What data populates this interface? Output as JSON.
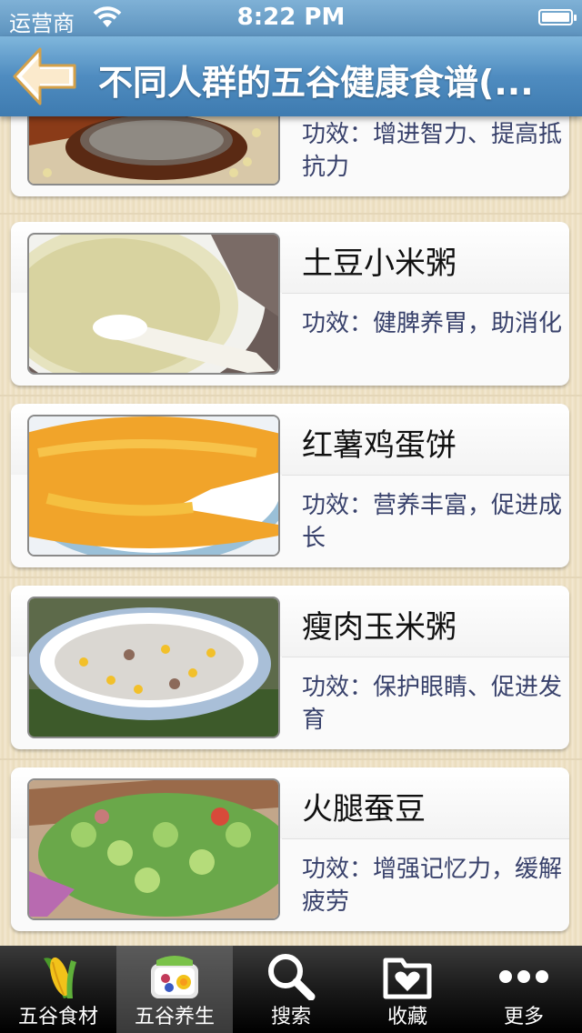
{
  "status_bar": {
    "carrier": "运营商",
    "time": "8:22 PM"
  },
  "nav": {
    "title": "不同人群的五谷健康食谱(...",
    "back_icon": "back-arrow-icon"
  },
  "items": [
    {
      "name": "",
      "desc": "功效：增进智力、提高抵抗力",
      "image": "grain-porridge-bowl"
    },
    {
      "name": "土豆小米粥",
      "desc": "功效：健脾养胃，助消化",
      "image": "millet-porridge"
    },
    {
      "name": "红薯鸡蛋饼",
      "desc": "功效：营养丰富，促进成长",
      "image": "egg-pancake"
    },
    {
      "name": "瘦肉玉米粥",
      "desc": "功效：保护眼睛、促进发育",
      "image": "corn-porridge"
    },
    {
      "name": "火腿蚕豆",
      "desc": "功效：增强记忆力，缓解疲劳",
      "image": "ham-broad-beans"
    }
  ],
  "tabs": [
    {
      "label": "五谷食材",
      "icon": "corn-icon",
      "active": false
    },
    {
      "label": "五谷养生",
      "icon": "bento-icon",
      "active": true
    },
    {
      "label": "搜索",
      "icon": "search-icon",
      "active": false
    },
    {
      "label": "收藏",
      "icon": "favorites-folder-icon",
      "active": false
    },
    {
      "label": "更多",
      "icon": "more-icon",
      "active": false
    }
  ]
}
